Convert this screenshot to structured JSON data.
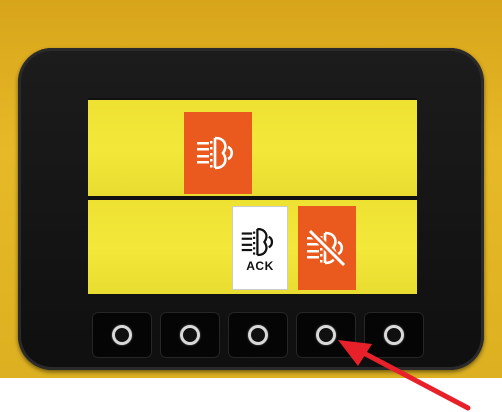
{
  "display": {
    "top_panel": {
      "icon": "headlight-icon"
    },
    "bottom_panel": {
      "ack_tile": {
        "icon": "headlight-icon",
        "label": "ACK"
      },
      "alert_tile": {
        "icon": "headlight-off-icon"
      }
    }
  },
  "buttons": [
    {
      "id": 1
    },
    {
      "id": 2
    },
    {
      "id": 3
    },
    {
      "id": 4
    },
    {
      "id": 5
    }
  ],
  "colors": {
    "housing": "#e2b322",
    "panel": "#f0e436",
    "tile_orange": "#ea5a1e",
    "arrow": "#e8202a"
  }
}
